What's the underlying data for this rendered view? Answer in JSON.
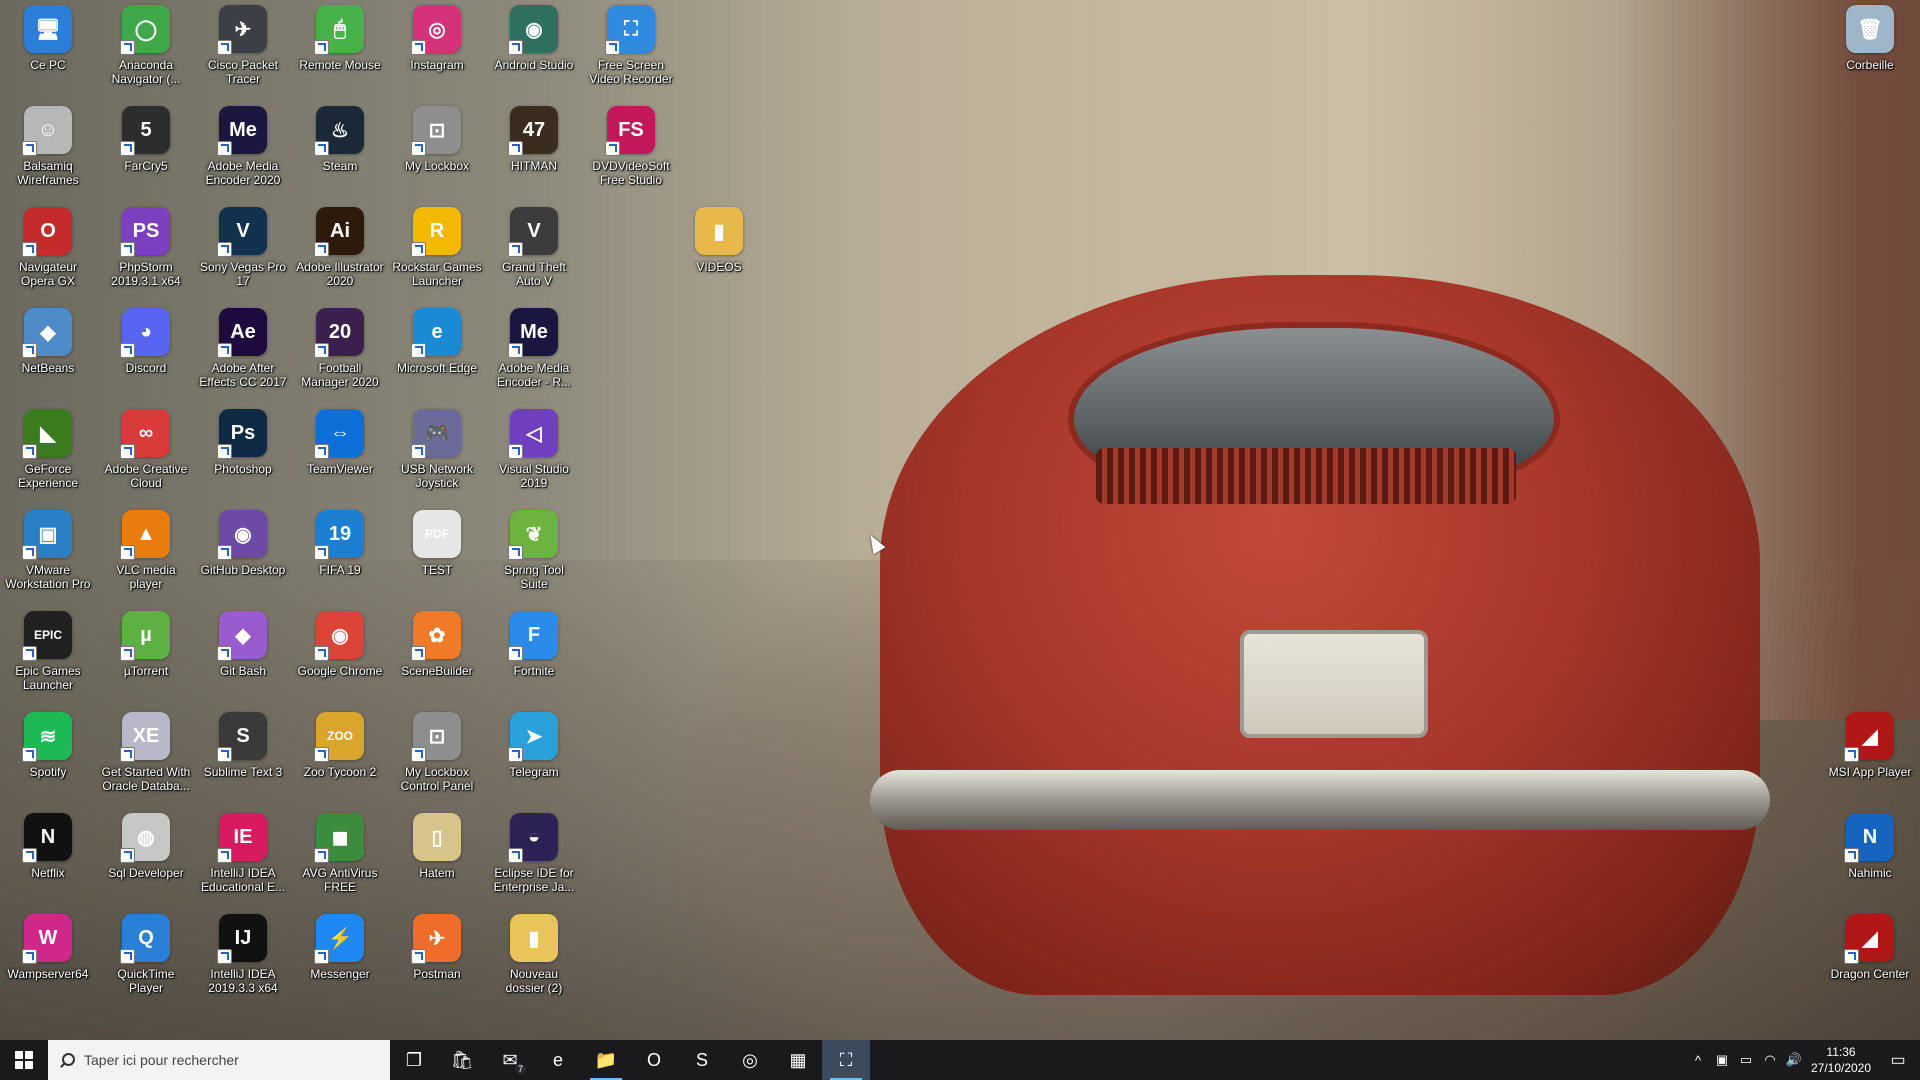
{
  "colors": {
    "taskbar": "#1a1a1c",
    "search_bg": "#f3f3f3",
    "accent": "#76b9ed"
  },
  "desktop_icons": [
    {
      "label": "Ce PC",
      "glyph": "🖥",
      "bg": "#2b7fd8",
      "icon": "computer-icon"
    },
    {
      "label": "Anaconda Navigator (...",
      "glyph": "◯",
      "bg": "#3fa84b",
      "icon": "anaconda-icon"
    },
    {
      "label": "Cisco Packet Tracer",
      "glyph": "✈",
      "bg": "#3c4046",
      "icon": "cisco-packet-tracer-icon"
    },
    {
      "label": "Remote Mouse",
      "glyph": "🖱",
      "bg": "#47b24a",
      "icon": "remote-mouse-icon"
    },
    {
      "label": "Instagram",
      "glyph": "◎",
      "bg": "#d6327a",
      "icon": "instagram-icon"
    },
    {
      "label": "Android Studio",
      "glyph": "◉",
      "bg": "#2f6f5f",
      "icon": "android-studio-icon"
    },
    {
      "label": "Free Screen Video Recorder",
      "glyph": "⛶",
      "bg": "#2f8be0",
      "icon": "screen-recorder-icon"
    },
    {
      "label": "Balsamiq Wireframes",
      "glyph": "☺",
      "bg": "#b7b7b7",
      "icon": "balsamiq-icon"
    },
    {
      "label": "FarCry5",
      "glyph": "5",
      "bg": "#2d2d2d",
      "icon": "farcry5-icon"
    },
    {
      "label": "Adobe Media Encoder 2020",
      "glyph": "Me",
      "bg": "#1b1640",
      "icon": "media-encoder-icon"
    },
    {
      "label": "Steam",
      "glyph": "♨",
      "bg": "#1b2838",
      "icon": "steam-icon"
    },
    {
      "label": "My Lockbox",
      "glyph": "⊡",
      "bg": "#8e8e8e",
      "icon": "lockbox-icon"
    },
    {
      "label": "HITMAN",
      "glyph": "47",
      "bg": "#3a2d1f",
      "icon": "hitman-icon"
    },
    {
      "label": "DVDVideoSoft Free Studio",
      "glyph": "FS",
      "bg": "#c2185b",
      "icon": "free-studio-icon"
    },
    {
      "label": "Navigateur Opera GX",
      "glyph": "O",
      "bg": "#c42b2b",
      "icon": "opera-gx-icon"
    },
    {
      "label": "PhpStorm 2019.3.1 x64",
      "glyph": "PS",
      "bg": "#7b3fbf",
      "icon": "phpstorm-icon"
    },
    {
      "label": "Sony Vegas Pro 17",
      "glyph": "V",
      "bg": "#12314f",
      "icon": "vegas-pro-icon"
    },
    {
      "label": "Adobe Illustrator 2020",
      "glyph": "Ai",
      "bg": "#2e1a0a",
      "icon": "illustrator-icon"
    },
    {
      "label": "Rockstar Games Launcher",
      "glyph": "R",
      "bg": "#f5b800",
      "icon": "rockstar-icon"
    },
    {
      "label": "Grand Theft Auto V",
      "glyph": "V",
      "bg": "#3c3c3c",
      "icon": "gta-icon"
    },
    {
      "label": "VIDEOS",
      "glyph": "▮",
      "bg": "#e8b84a",
      "icon": "folder-icon"
    },
    {
      "label": "NetBeans",
      "glyph": "◆",
      "bg": "#4f8ac9",
      "icon": "netbeans-icon"
    },
    {
      "label": "Discord",
      "glyph": "◕",
      "bg": "#5865f2",
      "icon": "discord-icon"
    },
    {
      "label": "Adobe After Effects CC 2017",
      "glyph": "Ae",
      "bg": "#1f0a3f",
      "icon": "after-effects-icon"
    },
    {
      "label": "Football Manager 2020",
      "glyph": "20",
      "bg": "#3a1f4f",
      "icon": "football-manager-icon"
    },
    {
      "label": "Microsoft Edge",
      "glyph": "e",
      "bg": "#1a8ad4",
      "icon": "edge-icon"
    },
    {
      "label": "Adobe Media Encoder - R...",
      "glyph": "Me",
      "bg": "#1b1640",
      "icon": "media-encoder-icon"
    },
    {
      "label": "GeForce Experience",
      "glyph": "◣",
      "bg": "#3b7d1e",
      "icon": "geforce-icon"
    },
    {
      "label": "Adobe Creative Cloud",
      "glyph": "∞",
      "bg": "#d93a3a",
      "icon": "creative-cloud-icon"
    },
    {
      "label": "Photoshop",
      "glyph": "Ps",
      "bg": "#0f2a44",
      "icon": "photoshop-icon"
    },
    {
      "label": "TeamViewer",
      "glyph": "⇔",
      "bg": "#0e6fd8",
      "icon": "teamviewer-icon"
    },
    {
      "label": "USB Network Joystick",
      "glyph": "🎮",
      "bg": "#6b6b9a",
      "icon": "joystick-icon"
    },
    {
      "label": "Visual Studio 2019",
      "glyph": "◁",
      "bg": "#6f3fbf",
      "icon": "visual-studio-icon"
    },
    {
      "label": "VMware Workstation Pro",
      "glyph": "▣",
      "bg": "#2b7fc4",
      "icon": "vmware-icon"
    },
    {
      "label": "VLC media player",
      "glyph": "▲",
      "bg": "#e87d0d",
      "icon": "vlc-icon"
    },
    {
      "label": "GitHub Desktop",
      "glyph": "◉",
      "bg": "#6e4aa6",
      "icon": "github-icon"
    },
    {
      "label": "FIFA 19",
      "glyph": "19",
      "bg": "#1c7fd1",
      "icon": "fifa-icon"
    },
    {
      "label": "TEST",
      "glyph": "PDF",
      "bg": "#e6e6e6",
      "icon": "pdf-icon"
    },
    {
      "label": "Spring Tool Suite",
      "glyph": "❦",
      "bg": "#6db33f",
      "icon": "spring-icon"
    },
    {
      "label": "Epic Games Launcher",
      "glyph": "EPIC",
      "bg": "#202020",
      "icon": "epic-games-icon"
    },
    {
      "label": "µTorrent",
      "glyph": "µ",
      "bg": "#5fb043",
      "icon": "utorrent-icon"
    },
    {
      "label": "Git Bash",
      "glyph": "◆",
      "bg": "#9a5bd0",
      "icon": "git-bash-icon"
    },
    {
      "label": "Google Chrome",
      "glyph": "◉",
      "bg": "#db4437",
      "icon": "chrome-icon"
    },
    {
      "label": "SceneBuilder",
      "glyph": "✿",
      "bg": "#f07a28",
      "icon": "scenebuilder-icon"
    },
    {
      "label": "Fortnite",
      "glyph": "F",
      "bg": "#2a8be8",
      "icon": "fortnite-icon"
    },
    {
      "label": "Spotify",
      "glyph": "≋",
      "bg": "#1db954",
      "icon": "spotify-icon"
    },
    {
      "label": "Get Started With Oracle Databa...",
      "glyph": "XE",
      "bg": "#b8b8c8",
      "icon": "oracle-icon"
    },
    {
      "label": "Sublime Text 3",
      "glyph": "S",
      "bg": "#3a3a3a",
      "icon": "sublime-icon"
    },
    {
      "label": "Zoo Tycoon 2",
      "glyph": "ZOO",
      "bg": "#d9a52b",
      "icon": "zoo-tycoon-icon"
    },
    {
      "label": "My Lockbox Control Panel",
      "glyph": "⊡",
      "bg": "#8e8e8e",
      "icon": "lockbox-icon"
    },
    {
      "label": "Telegram",
      "glyph": "➤",
      "bg": "#2aa1da",
      "icon": "telegram-icon"
    },
    {
      "label": "Netflix",
      "glyph": "N",
      "bg": "#111111",
      "icon": "netflix-icon"
    },
    {
      "label": "Sql Developer",
      "glyph": "◍",
      "bg": "#c7c7c7",
      "icon": "sql-developer-icon"
    },
    {
      "label": "IntelliJ IDEA Educational E...",
      "glyph": "IE",
      "bg": "#d81b60",
      "icon": "intellij-edu-icon"
    },
    {
      "label": "AVG AntiVirus FREE",
      "glyph": "◼",
      "bg": "#3d8b3d",
      "icon": "avg-icon"
    },
    {
      "label": "Hatem",
      "glyph": "▯",
      "bg": "#d6c48a",
      "icon": "file-icon"
    },
    {
      "label": "Eclipse IDE for Enterprise Ja...",
      "glyph": "◒",
      "bg": "#2c2255",
      "icon": "eclipse-icon"
    },
    {
      "label": "Wampserver64",
      "glyph": "W",
      "bg": "#d0288a",
      "icon": "wampserver-icon"
    },
    {
      "label": "QuickTime Player",
      "glyph": "Q",
      "bg": "#2a7fd6",
      "icon": "quicktime-icon"
    },
    {
      "label": "IntelliJ IDEA 2019.3.3 x64",
      "glyph": "IJ",
      "bg": "#111111",
      "icon": "intellij-icon"
    },
    {
      "label": "Messenger",
      "glyph": "⚡",
      "bg": "#1e88f5",
      "icon": "messenger-icon"
    },
    {
      "label": "Postman",
      "glyph": "✈",
      "bg": "#ef6c2a",
      "icon": "postman-icon"
    },
    {
      "label": "Nouveau dossier (2)",
      "glyph": "▮",
      "bg": "#e8c45a",
      "icon": "folder-icon"
    },
    {
      "label": "Corbeille",
      "glyph": "🗑",
      "bg": "#9fb6c8",
      "icon": "recycle-bin-icon"
    },
    {
      "label": "MSI App Player",
      "glyph": "◢",
      "bg": "#b01717",
      "icon": "msi-app-player-icon"
    },
    {
      "label": "Nahimic",
      "glyph": "N",
      "bg": "#1565c0",
      "icon": "nahimic-icon"
    },
    {
      "label": "Dragon Center",
      "glyph": "◢",
      "bg": "#b01717",
      "icon": "dragon-center-icon"
    }
  ],
  "taskbar": {
    "search_placeholder": "Taper ici pour rechercher",
    "mail_badge": "7",
    "apps": [
      {
        "name": "task-view-icon",
        "glyph": "❐",
        "running": false,
        "active": false
      },
      {
        "name": "store-icon",
        "glyph": "🛍",
        "running": false,
        "active": false
      },
      {
        "name": "mail-icon",
        "glyph": "✉",
        "running": false,
        "active": false
      },
      {
        "name": "edge-icon",
        "glyph": "e",
        "running": false,
        "active": false
      },
      {
        "name": "file-explorer-icon",
        "glyph": "📁",
        "running": true,
        "active": false
      },
      {
        "name": "opera-icon",
        "glyph": "O",
        "running": false,
        "active": false
      },
      {
        "name": "sublime-icon",
        "glyph": "S",
        "running": false,
        "active": false
      },
      {
        "name": "media-player-icon",
        "glyph": "◎",
        "running": false,
        "active": false
      },
      {
        "name": "windows-store-icon",
        "glyph": "▦",
        "running": false,
        "active": false
      },
      {
        "name": "screen-recorder-icon",
        "glyph": "⛶",
        "running": true,
        "active": true
      }
    ],
    "tray": [
      {
        "name": "chevron-up-icon",
        "glyph": "^"
      },
      {
        "name": "app-tray-icon",
        "glyph": "▣"
      },
      {
        "name": "battery-icon",
        "glyph": "▭"
      },
      {
        "name": "wifi-icon",
        "glyph": "◠"
      },
      {
        "name": "volume-icon",
        "glyph": "🔊"
      }
    ],
    "time": "11:36",
    "date": "27/10/2020"
  }
}
